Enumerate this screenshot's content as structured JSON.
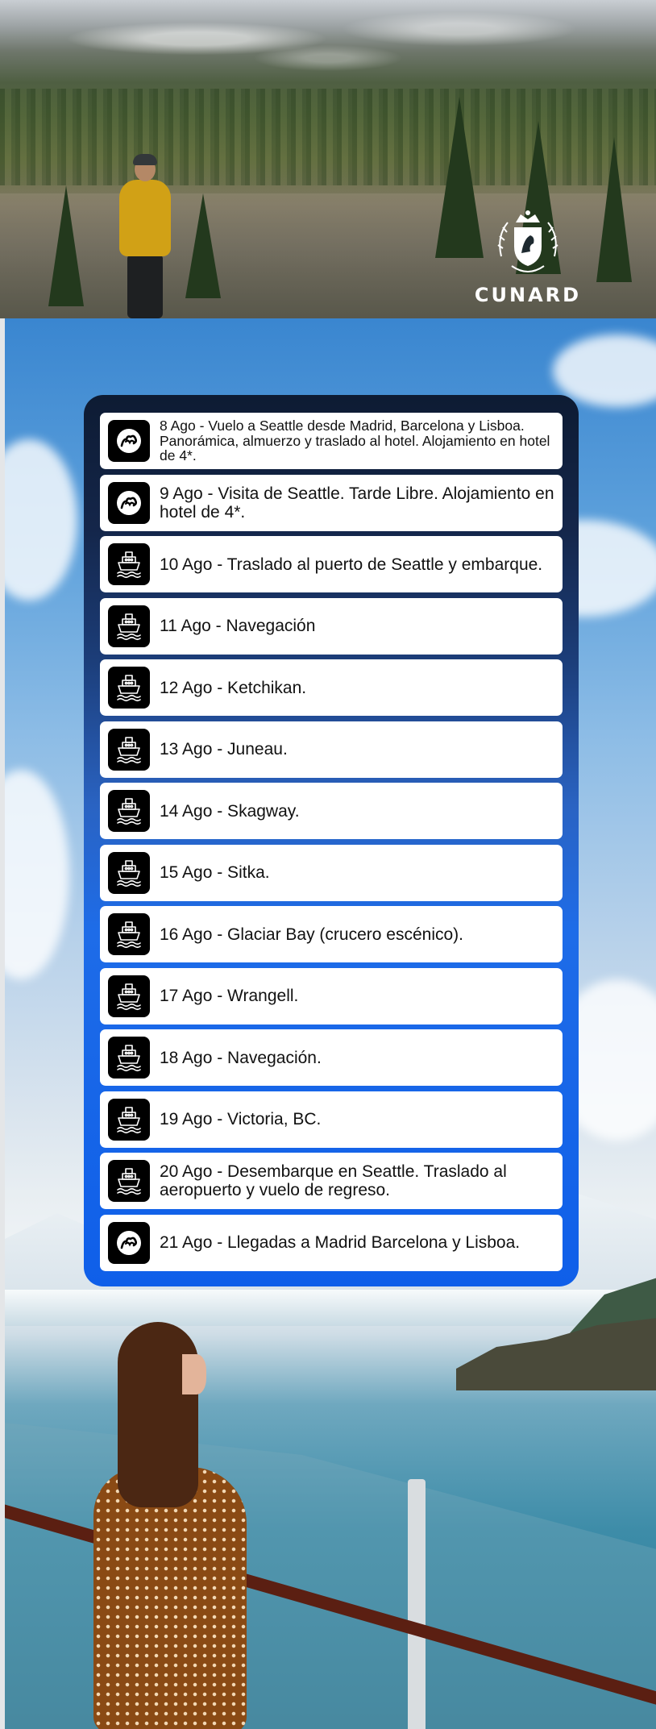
{
  "brand": {
    "name": "CUNARD"
  },
  "itinerary": [
    {
      "text": "8 Ago - Vuelo a Seattle desde Madrid, Barcelona y Lisboa. Panorámica, almuerzo y traslado al hotel. Alojamiento en hotel de 4*.",
      "icon": "circle-logo-icon"
    },
    {
      "text": "9 Ago - Visita de Seattle. Tarde Libre. Alojamiento en hotel de 4*.",
      "icon": "circle-logo-icon"
    },
    {
      "text": "10 Ago - Traslado al puerto de Seattle y embarque.",
      "icon": "ship-icon"
    },
    {
      "text": "11 Ago - Navegación",
      "icon": "ship-icon"
    },
    {
      "text": "12 Ago - Ketchikan.",
      "icon": "ship-icon"
    },
    {
      "text": "13 Ago - Juneau.",
      "icon": "ship-icon"
    },
    {
      "text": "14 Ago - Skagway.",
      "icon": "ship-icon"
    },
    {
      "text": "15 Ago - Sitka.",
      "icon": "ship-icon"
    },
    {
      "text": "16 Ago - Glaciar Bay (crucero escénico).",
      "icon": "ship-icon"
    },
    {
      "text": "17 Ago - Wrangell.",
      "icon": "ship-icon"
    },
    {
      "text": "18 Ago - Navegación.",
      "icon": "ship-icon"
    },
    {
      "text": "19 Ago - Victoria, BC.",
      "icon": "ship-icon"
    },
    {
      "text": "20 Ago - Desembarque en Seattle. Traslado al aeropuerto y vuelo de regreso.",
      "icon": "ship-icon"
    },
    {
      "text": "21 Ago - Llegadas a Madrid Barcelona y Lisboa.",
      "icon": "circle-logo-icon"
    }
  ]
}
